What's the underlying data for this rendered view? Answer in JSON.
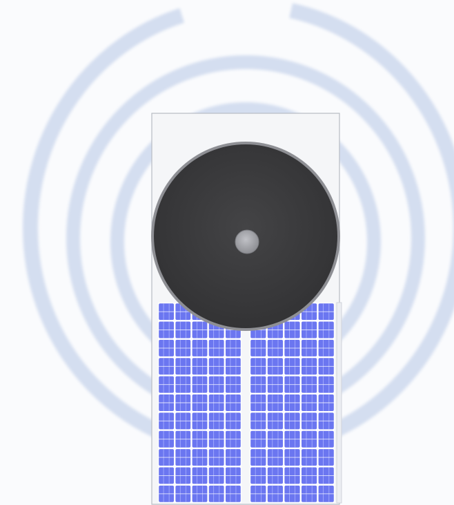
{
  "scene": {
    "subject": "wireless-solar-charger-device",
    "colors": {
      "background": "#fafbfd",
      "signal_rings": "#d4def0",
      "device_body": "#f5f6f8",
      "device_outline": "#b8bcc4",
      "speaker_disc": "#3c3c3e",
      "speaker_rim": "#8e8f94",
      "center_button": "#a9aab0",
      "solar_cell": "#6b76f0",
      "solar_grid": "#ffffff",
      "panel_frame": "#d0d3da"
    },
    "solar_panels": {
      "count": 2,
      "cell_columns": 5,
      "cell_rows": 11
    },
    "signal_rings": {
      "count": 3
    }
  }
}
